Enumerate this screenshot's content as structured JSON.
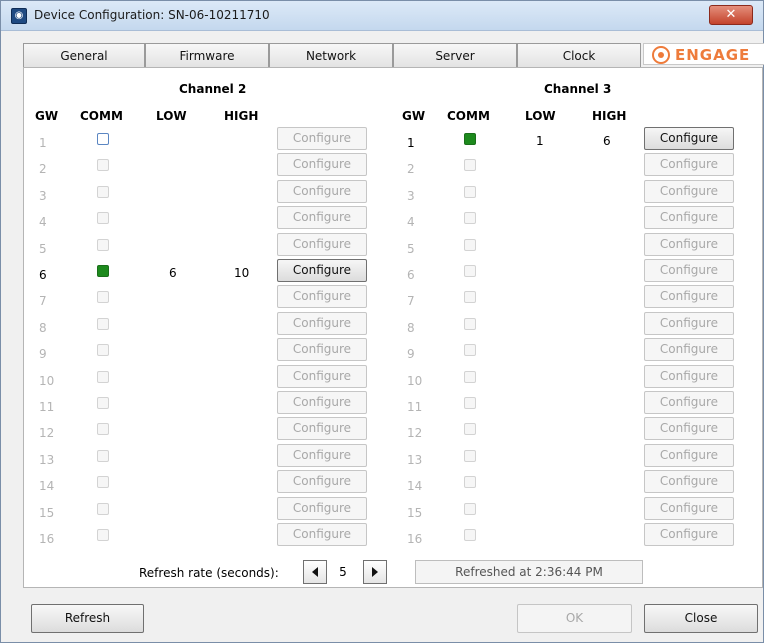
{
  "window": {
    "title": "Device Configuration: SN-06-10211710",
    "close_glyph": "✕"
  },
  "tabs": [
    "General",
    "Firmware",
    "Network",
    "Server",
    "Clock"
  ],
  "brand": {
    "text": "ENGAGE",
    "color": "#ee7b3b"
  },
  "headers": {
    "gw": "GW",
    "comm": "COMM",
    "low": "LOW",
    "high": "HIGH"
  },
  "configure_label": "Configure",
  "channels": [
    {
      "title": "Channel 2",
      "rows": [
        {
          "gw": "1",
          "active": false,
          "comm": "empty",
          "low": "",
          "high": ""
        },
        {
          "gw": "2",
          "active": false,
          "comm": "disabled",
          "low": "",
          "high": ""
        },
        {
          "gw": "3",
          "active": false,
          "comm": "disabled",
          "low": "",
          "high": ""
        },
        {
          "gw": "4",
          "active": false,
          "comm": "disabled",
          "low": "",
          "high": ""
        },
        {
          "gw": "5",
          "active": false,
          "comm": "disabled",
          "low": "",
          "high": ""
        },
        {
          "gw": "6",
          "active": true,
          "comm": "on",
          "low": "6",
          "high": "10"
        },
        {
          "gw": "7",
          "active": false,
          "comm": "disabled",
          "low": "",
          "high": ""
        },
        {
          "gw": "8",
          "active": false,
          "comm": "disabled",
          "low": "",
          "high": ""
        },
        {
          "gw": "9",
          "active": false,
          "comm": "disabled",
          "low": "",
          "high": ""
        },
        {
          "gw": "10",
          "active": false,
          "comm": "disabled",
          "low": "",
          "high": ""
        },
        {
          "gw": "11",
          "active": false,
          "comm": "disabled",
          "low": "",
          "high": ""
        },
        {
          "gw": "12",
          "active": false,
          "comm": "disabled",
          "low": "",
          "high": ""
        },
        {
          "gw": "13",
          "active": false,
          "comm": "disabled",
          "low": "",
          "high": ""
        },
        {
          "gw": "14",
          "active": false,
          "comm": "disabled",
          "low": "",
          "high": ""
        },
        {
          "gw": "15",
          "active": false,
          "comm": "disabled",
          "low": "",
          "high": ""
        },
        {
          "gw": "16",
          "active": false,
          "comm": "disabled",
          "low": "",
          "high": ""
        }
      ]
    },
    {
      "title": "Channel 3",
      "rows": [
        {
          "gw": "1",
          "active": true,
          "comm": "on",
          "low": "1",
          "high": "6"
        },
        {
          "gw": "2",
          "active": false,
          "comm": "disabled",
          "low": "",
          "high": ""
        },
        {
          "gw": "3",
          "active": false,
          "comm": "disabled",
          "low": "",
          "high": ""
        },
        {
          "gw": "4",
          "active": false,
          "comm": "disabled",
          "low": "",
          "high": ""
        },
        {
          "gw": "5",
          "active": false,
          "comm": "disabled",
          "low": "",
          "high": ""
        },
        {
          "gw": "6",
          "active": false,
          "comm": "disabled",
          "low": "",
          "high": ""
        },
        {
          "gw": "7",
          "active": false,
          "comm": "disabled",
          "low": "",
          "high": ""
        },
        {
          "gw": "8",
          "active": false,
          "comm": "disabled",
          "low": "",
          "high": ""
        },
        {
          "gw": "9",
          "active": false,
          "comm": "disabled",
          "low": "",
          "high": ""
        },
        {
          "gw": "10",
          "active": false,
          "comm": "disabled",
          "low": "",
          "high": ""
        },
        {
          "gw": "11",
          "active": false,
          "comm": "disabled",
          "low": "",
          "high": ""
        },
        {
          "gw": "12",
          "active": false,
          "comm": "disabled",
          "low": "",
          "high": ""
        },
        {
          "gw": "13",
          "active": false,
          "comm": "disabled",
          "low": "",
          "high": ""
        },
        {
          "gw": "14",
          "active": false,
          "comm": "disabled",
          "low": "",
          "high": ""
        },
        {
          "gw": "15",
          "active": false,
          "comm": "disabled",
          "low": "",
          "high": ""
        },
        {
          "gw": "16",
          "active": false,
          "comm": "disabled",
          "low": "",
          "high": ""
        }
      ]
    }
  ],
  "refresh": {
    "label": "Refresh rate (seconds):",
    "value": "5",
    "status": "Refreshed at 2:36:44 PM"
  },
  "buttons": {
    "refresh": "Refresh",
    "ok": "OK",
    "close": "Close"
  },
  "colors": {
    "comm_on": "#1d8a1d",
    "accent": "#ee7b3b"
  }
}
